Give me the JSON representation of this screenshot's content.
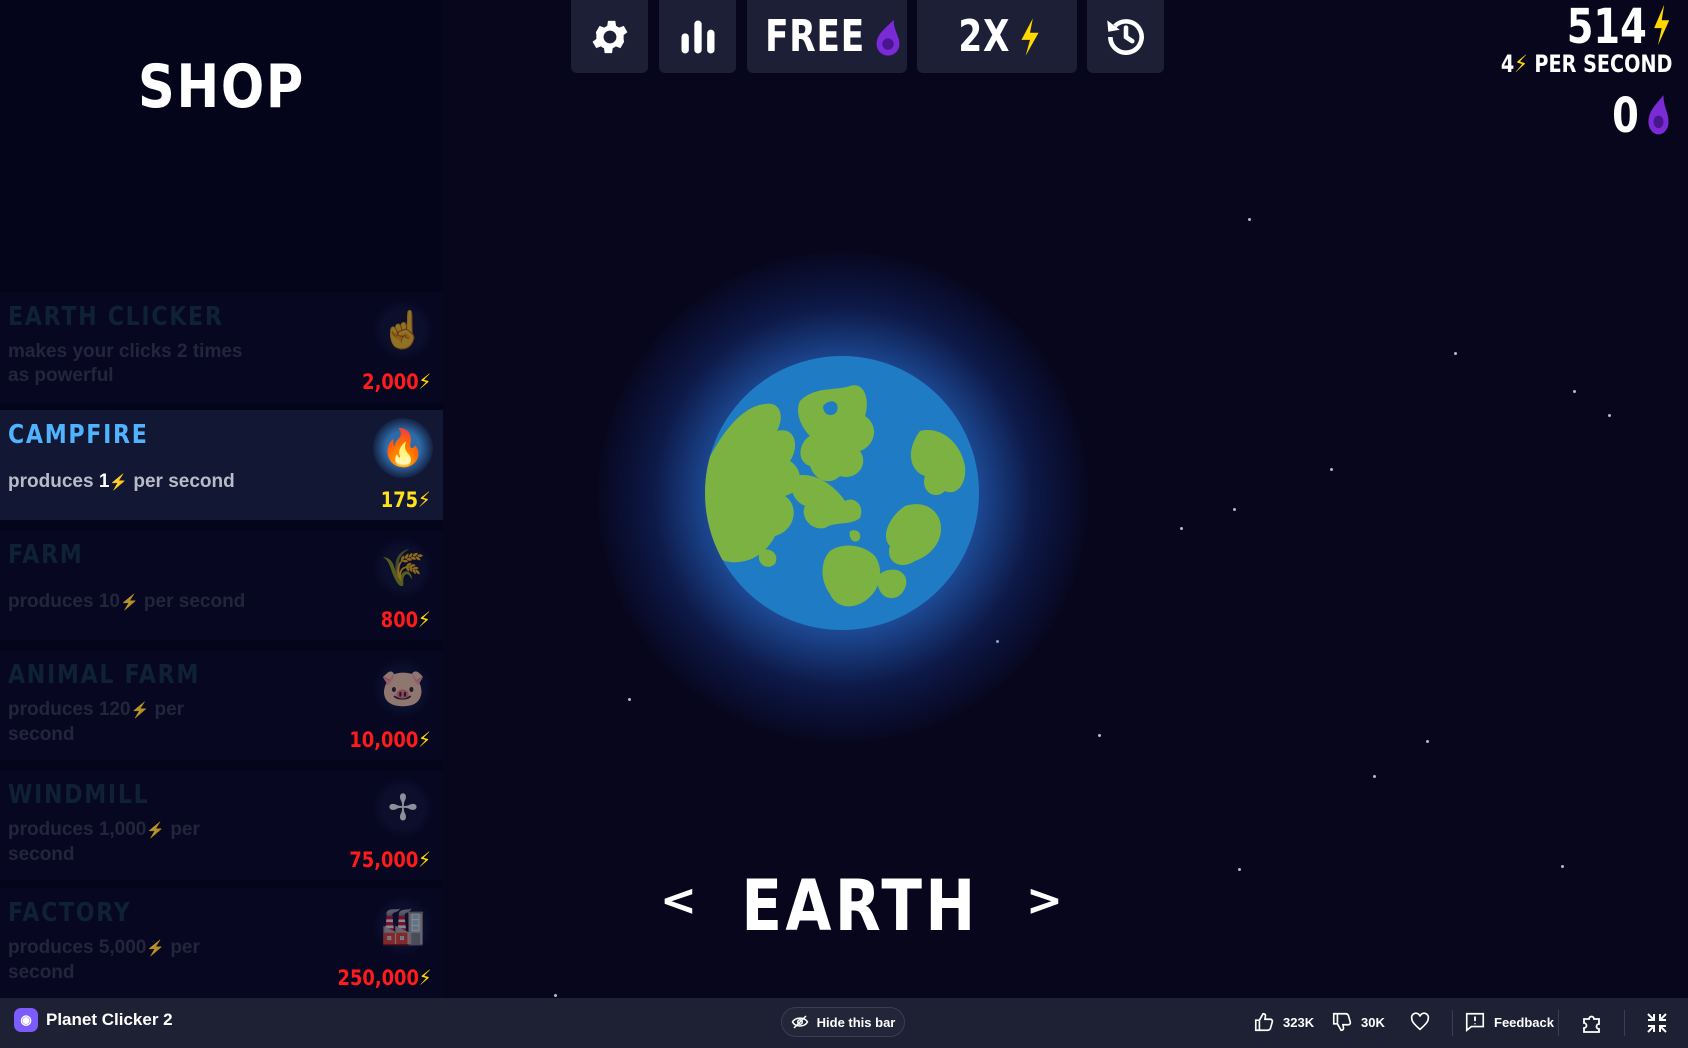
{
  "shop": {
    "title": "SHOP",
    "items": [
      {
        "name": "EARTH CLICKER",
        "desc_pre": "makes your clicks ",
        "desc_num": "2",
        "desc_post": " times as powerful",
        "price": "2,000",
        "icon": "hand-pointer-icon"
      },
      {
        "name": "CAMPFIRE",
        "desc_pre": "produces ",
        "desc_num": "1",
        "desc_post": " per second",
        "price": "175",
        "icon": "campfire-icon"
      },
      {
        "name": "FARM",
        "desc_pre": "produces ",
        "desc_num": "10",
        "desc_post": " per second",
        "price": "800",
        "icon": "farm-icon"
      },
      {
        "name": "ANIMAL FARM",
        "desc_pre": "produces ",
        "desc_num": "120",
        "desc_post": " per second",
        "price": "10,000",
        "icon": "pig-icon"
      },
      {
        "name": "WINDMILL",
        "desc_pre": "produces ",
        "desc_num": "1,000",
        "desc_post": " per second",
        "price": "75,000",
        "icon": "windmill-icon"
      },
      {
        "name": "FACTORY",
        "desc_pre": "produces ",
        "desc_num": "5,000",
        "desc_post": " per second",
        "price": "250,000",
        "icon": "factory-icon"
      }
    ]
  },
  "toolbar": {
    "free_label": "FREE",
    "boost_label": "2X"
  },
  "stats": {
    "energy": "514",
    "per_second_value": "4",
    "per_second_label": "PER SECOND",
    "dark_matter": "0"
  },
  "planet": {
    "name": "EARTH",
    "prev": "<",
    "next": ">"
  },
  "bottom_bar": {
    "game_title": "Planet Clicker 2",
    "hide_label": "Hide this bar",
    "likes": "323K",
    "dislikes": "30K",
    "feedback_label": "Feedback"
  },
  "colors": {
    "energy_bolt": "#ffd800",
    "dark_matter": "#7a2bd6",
    "price_unaffordable": "#ff1b1b",
    "price_affordable": "#ffe21a",
    "active_item_name": "#4fb3ff"
  }
}
